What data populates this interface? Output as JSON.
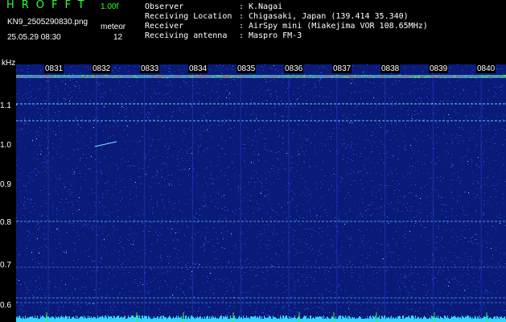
{
  "header": {
    "app_title": "HROFFT",
    "version": "1.00f",
    "filename": "KN9_2505290830.png",
    "unit": "meteor",
    "datetime": "25.05.29 08:30",
    "count": "12",
    "info": [
      {
        "key": "Observer",
        "colon": ":",
        "value": "K.Nagai"
      },
      {
        "key": "Receiving Location",
        "colon": ":",
        "value": "Chigasaki, Japan (139.414 35.340)"
      },
      {
        "key": "Receiver",
        "colon": ":",
        "value": "AirSpy mini (Miakejima VOR 108.65MHz)"
      },
      {
        "key": "Receiving antenna",
        "colon": ":",
        "value": "Maspro FM-3"
      }
    ]
  },
  "axis": {
    "unit_label": "kHz",
    "y_ticks": [
      "1.1",
      "1.0",
      "0.9",
      "0.8",
      "0.7",
      "0.6"
    ],
    "time_labels": [
      "0831",
      "0832",
      "0833",
      "0834",
      "0835",
      "0836",
      "0837",
      "0838",
      "0839",
      "0840"
    ]
  },
  "colors": {
    "background": "#0a1a78",
    "noise": "#2a5cff",
    "line": "#7fe8ff",
    "green": "#2cff2c",
    "bottom": "#33d6ff",
    "red": "#ff3a3a"
  }
}
